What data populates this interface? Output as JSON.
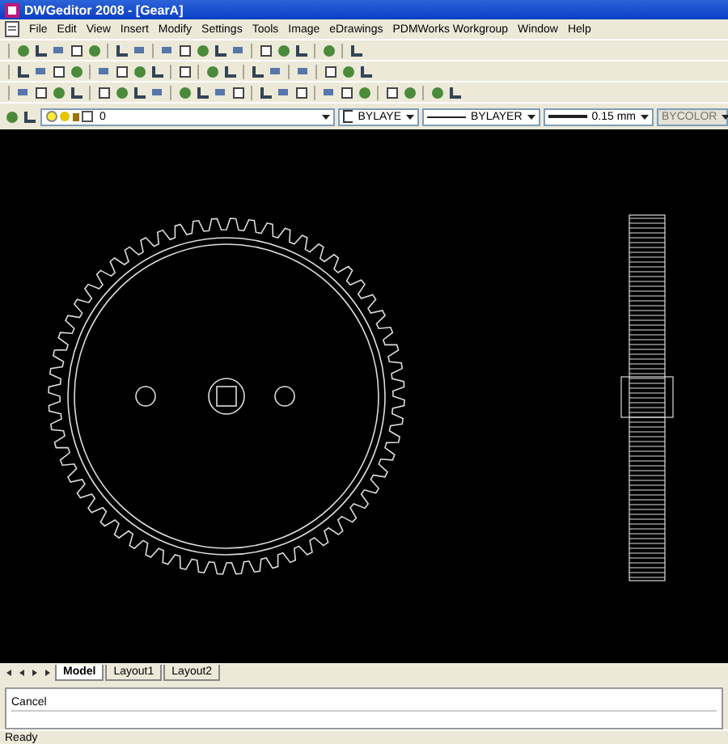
{
  "window": {
    "title": "DWGeditor 2008 - [GearA]"
  },
  "menu": [
    "File",
    "Edit",
    "View",
    "Insert",
    "Modify",
    "Settings",
    "Tools",
    "Image",
    "eDrawings",
    "PDMWorks Workgroup",
    "Window",
    "Help"
  ],
  "properties": [
    {
      "kind": "layer",
      "value": "0",
      "disabled": false
    },
    {
      "kind": "color",
      "value": "BYLAYE",
      "disabled": false
    },
    {
      "kind": "linetype",
      "value": "BYLAYER",
      "disabled": false
    },
    {
      "kind": "lineweight",
      "value": "0.15 mm",
      "disabled": false
    },
    {
      "kind": "plotstyle",
      "value": "BYCOLOR",
      "disabled": true
    }
  ],
  "layout_tabs": [
    {
      "label": "Model",
      "selected": true
    },
    {
      "label": "Layout1",
      "selected": false
    },
    {
      "label": "Layout2",
      "selected": false
    }
  ],
  "command_lines": [
    "Cancel"
  ],
  "status_bar": "Ready"
}
